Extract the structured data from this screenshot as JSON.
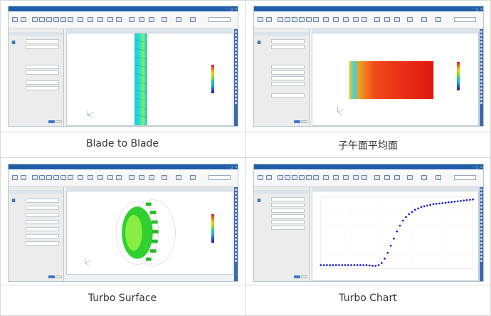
{
  "captions": {
    "blade_to_blade": "Blade to Blade",
    "meridional_average": "子午面平均面",
    "turbo_surface": "Turbo Surface",
    "turbo_chart": "Turbo Chart"
  },
  "colors": {
    "titlebar": "#1f5fa8",
    "accent": "#3b78c4",
    "blade_green": "#2fd02f",
    "chart_points": "#1a1adc"
  },
  "chart_data": {
    "type": "scatter",
    "x": [
      0.0,
      0.02,
      0.04,
      0.06,
      0.08,
      0.1,
      0.12,
      0.14,
      0.16,
      0.18,
      0.2,
      0.22,
      0.24,
      0.26,
      0.28,
      0.3,
      0.32,
      0.34,
      0.36,
      0.38,
      0.4,
      0.42,
      0.44,
      0.46,
      0.48,
      0.5,
      0.52,
      0.54,
      0.56,
      0.58,
      0.6,
      0.62,
      0.64,
      0.66,
      0.68,
      0.7,
      0.72,
      0.74,
      0.76,
      0.78,
      0.8,
      0.82,
      0.84,
      0.86,
      0.88,
      0.9,
      0.92,
      0.94,
      0.96,
      0.98,
      1.0
    ],
    "y": [
      0.05,
      0.05,
      0.05,
      0.05,
      0.05,
      0.05,
      0.05,
      0.05,
      0.05,
      0.05,
      0.05,
      0.05,
      0.05,
      0.05,
      0.05,
      0.05,
      0.045,
      0.04,
      0.04,
      0.05,
      0.08,
      0.14,
      0.22,
      0.32,
      0.42,
      0.52,
      0.6,
      0.67,
      0.72,
      0.76,
      0.79,
      0.82,
      0.84,
      0.86,
      0.87,
      0.88,
      0.89,
      0.9,
      0.905,
      0.91,
      0.915,
      0.92,
      0.925,
      0.93,
      0.935,
      0.94,
      0.945,
      0.95,
      0.955,
      0.96,
      0.965
    ],
    "xlim": [
      0,
      1
    ],
    "ylim": [
      0,
      1
    ],
    "grid": true,
    "legend": "bottom"
  }
}
